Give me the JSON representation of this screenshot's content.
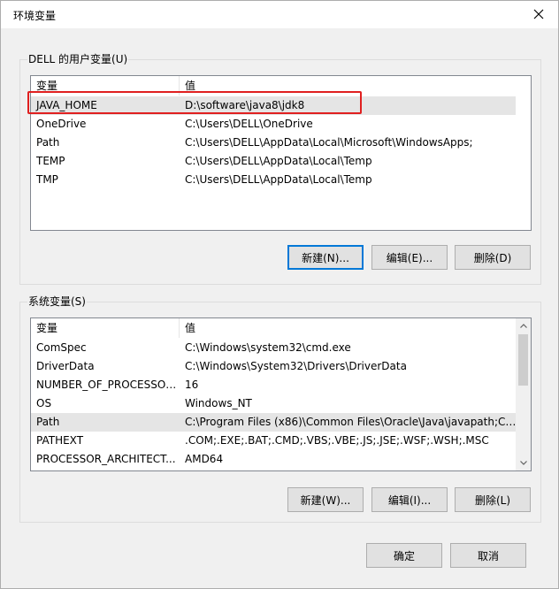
{
  "window": {
    "title": "环境变量"
  },
  "user_vars": {
    "group_label": "DELL 的用户变量(U)",
    "col_name": "变量",
    "col_value": "值",
    "rows": [
      {
        "name": "JAVA_HOME",
        "value": "D:\\software\\java8\\jdk8"
      },
      {
        "name": "OneDrive",
        "value": "C:\\Users\\DELL\\OneDrive"
      },
      {
        "name": "Path",
        "value": "C:\\Users\\DELL\\AppData\\Local\\Microsoft\\WindowsApps;"
      },
      {
        "name": "TEMP",
        "value": "C:\\Users\\DELL\\AppData\\Local\\Temp"
      },
      {
        "name": "TMP",
        "value": "C:\\Users\\DELL\\AppData\\Local\\Temp"
      }
    ],
    "new_label": "新建(N)...",
    "edit_label": "编辑(E)...",
    "delete_label": "删除(D)"
  },
  "system_vars": {
    "group_label": "系统变量(S)",
    "col_name": "变量",
    "col_value": "值",
    "rows": [
      {
        "name": "ComSpec",
        "value": "C:\\Windows\\system32\\cmd.exe"
      },
      {
        "name": "DriverData",
        "value": "C:\\Windows\\System32\\Drivers\\DriverData"
      },
      {
        "name": "NUMBER_OF_PROCESSORS",
        "value": "16"
      },
      {
        "name": "OS",
        "value": "Windows_NT"
      },
      {
        "name": "Path",
        "value": "C:\\Program Files (x86)\\Common Files\\Oracle\\Java\\javapath;C:..."
      },
      {
        "name": "PATHEXT",
        "value": ".COM;.EXE;.BAT;.CMD;.VBS;.VBE;.JS;.JSE;.WSF;.WSH;.MSC"
      },
      {
        "name": "PROCESSOR_ARCHITECT...",
        "value": "AMD64"
      }
    ],
    "new_label": "新建(W)...",
    "edit_label": "编辑(I)...",
    "delete_label": "删除(L)"
  },
  "footer": {
    "ok_label": "确定",
    "cancel_label": "取消"
  },
  "icons": {
    "close": "close-icon",
    "scroll_up": "chevron-up-icon",
    "scroll_down": "chevron-down-icon"
  },
  "colors": {
    "highlight": "#e02020",
    "selection": "#e5e5e5",
    "default_button_border": "#0078d7"
  }
}
